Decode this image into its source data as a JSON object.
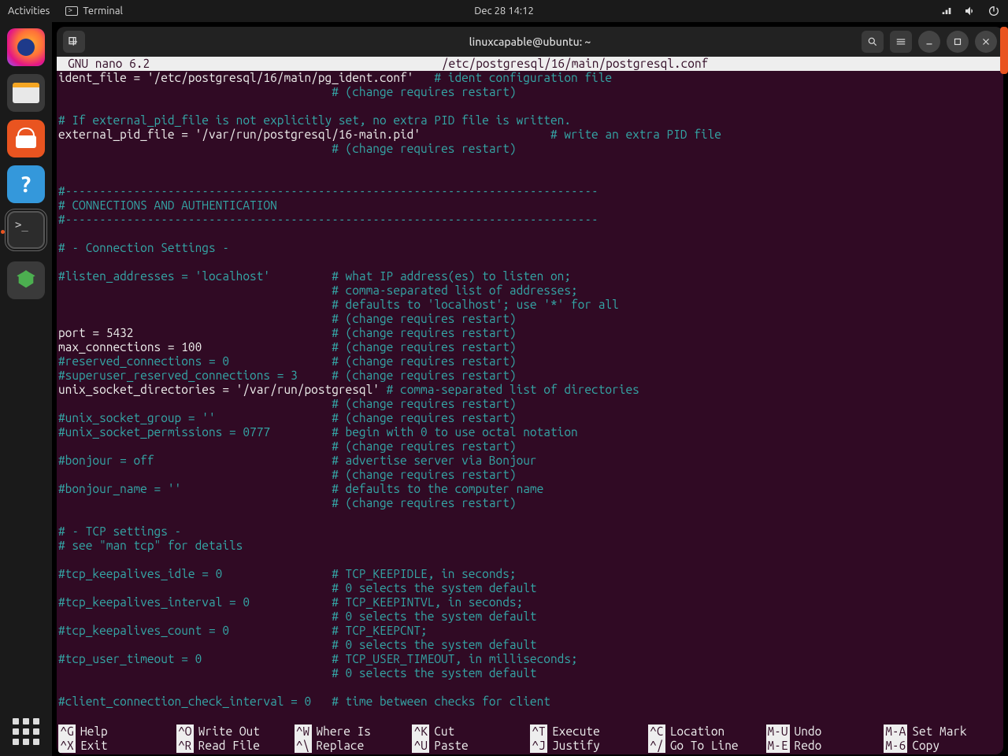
{
  "topbar": {
    "activities": "Activities",
    "terminal": "Terminal",
    "clock": "Dec 28  14:12"
  },
  "window": {
    "title": "linuxcapable@ubuntu: ~"
  },
  "nano": {
    "version": "GNU nano  6.2",
    "filepath": "/etc/postgresql/16/main/postgresql.conf",
    "lines": [
      {
        "t": "n",
        "s": "ident_file = '/etc/postgresql/16/main/pg_ident.conf'   "
      },
      {
        "t": "c",
        "s": "# ident configuration file"
      },
      "BR",
      {
        "t": "c",
        "s": "                                        # (change requires restart)"
      },
      "BR",
      "BR",
      {
        "t": "c",
        "s": "# If external_pid_file is not explicitly set, no extra PID file is written."
      },
      "BR",
      {
        "t": "n",
        "s": "external_pid_file = '/var/run/postgresql/16-main.pid'                   "
      },
      {
        "t": "c",
        "s": "# write an extra PID file"
      },
      "BR",
      {
        "t": "c",
        "s": "                                        # (change requires restart)"
      },
      "BR",
      "BR",
      "BR",
      {
        "t": "c",
        "s": "#------------------------------------------------------------------------------"
      },
      "BR",
      {
        "t": "c",
        "s": "# CONNECTIONS AND AUTHENTICATION"
      },
      "BR",
      {
        "t": "c",
        "s": "#------------------------------------------------------------------------------"
      },
      "BR",
      "BR",
      {
        "t": "c",
        "s": "# - Connection Settings -"
      },
      "BR",
      "BR",
      {
        "t": "c",
        "s": "#listen_addresses = 'localhost'         # what IP address(es) to listen on;"
      },
      "BR",
      {
        "t": "c",
        "s": "                                        # comma-separated list of addresses;"
      },
      "BR",
      {
        "t": "c",
        "s": "                                        # defaults to 'localhost'; use '*' for all"
      },
      "BR",
      {
        "t": "c",
        "s": "                                        # (change requires restart)"
      },
      "BR",
      {
        "t": "n",
        "s": "port = 5432                             "
      },
      {
        "t": "c",
        "s": "# (change requires restart)"
      },
      "BR",
      {
        "t": "n",
        "s": "max_connections = 100                   "
      },
      {
        "t": "c",
        "s": "# (change requires restart)"
      },
      "BR",
      {
        "t": "c",
        "s": "#reserved_connections = 0               # (change requires restart)"
      },
      "BR",
      {
        "t": "c",
        "s": "#superuser_reserved_connections = 3     # (change requires restart)"
      },
      "BR",
      {
        "t": "n",
        "s": "unix_socket_directories = '/var/run/postgresql' "
      },
      {
        "t": "c",
        "s": "# comma-separated list of directories"
      },
      "BR",
      {
        "t": "c",
        "s": "                                        # (change requires restart)"
      },
      "BR",
      {
        "t": "c",
        "s": "#unix_socket_group = ''                 # (change requires restart)"
      },
      "BR",
      {
        "t": "c",
        "s": "#unix_socket_permissions = 0777         # begin with 0 to use octal notation"
      },
      "BR",
      {
        "t": "c",
        "s": "                                        # (change requires restart)"
      },
      "BR",
      {
        "t": "c",
        "s": "#bonjour = off                          # advertise server via Bonjour"
      },
      "BR",
      {
        "t": "c",
        "s": "                                        # (change requires restart)"
      },
      "BR",
      {
        "t": "c",
        "s": "#bonjour_name = ''                      # defaults to the computer name"
      },
      "BR",
      {
        "t": "c",
        "s": "                                        # (change requires restart)"
      },
      "BR",
      "BR",
      {
        "t": "c",
        "s": "# - TCP settings -"
      },
      "BR",
      {
        "t": "c",
        "s": "# see \"man tcp\" for details"
      },
      "BR",
      "BR",
      {
        "t": "c",
        "s": "#tcp_keepalives_idle = 0                # TCP_KEEPIDLE, in seconds;"
      },
      "BR",
      {
        "t": "c",
        "s": "                                        # 0 selects the system default"
      },
      "BR",
      {
        "t": "c",
        "s": "#tcp_keepalives_interval = 0            # TCP_KEEPINTVL, in seconds;"
      },
      "BR",
      {
        "t": "c",
        "s": "                                        # 0 selects the system default"
      },
      "BR",
      {
        "t": "c",
        "s": "#tcp_keepalives_count = 0               # TCP_KEEPCNT;"
      },
      "BR",
      {
        "t": "c",
        "s": "                                        # 0 selects the system default"
      },
      "BR",
      {
        "t": "c",
        "s": "#tcp_user_timeout = 0                   # TCP_USER_TIMEOUT, in milliseconds;"
      },
      "BR",
      {
        "t": "c",
        "s": "                                        # 0 selects the system default"
      },
      "BR",
      "BR",
      {
        "t": "c",
        "s": "#client_connection_check_interval = 0   # time between checks for client"
      },
      "BR"
    ],
    "shortcuts": [
      {
        "k": "^G",
        "l": "Help"
      },
      {
        "k": "^O",
        "l": "Write Out"
      },
      {
        "k": "^W",
        "l": "Where Is"
      },
      {
        "k": "^K",
        "l": "Cut"
      },
      {
        "k": "^T",
        "l": "Execute"
      },
      {
        "k": "^C",
        "l": "Location"
      },
      {
        "k": "M-U",
        "l": "Undo"
      },
      {
        "k": "M-A",
        "l": "Set Mark"
      },
      {
        "k": "^X",
        "l": "Exit"
      },
      {
        "k": "^R",
        "l": "Read File"
      },
      {
        "k": "^\\",
        "l": "Replace"
      },
      {
        "k": "^U",
        "l": "Paste"
      },
      {
        "k": "^J",
        "l": "Justify"
      },
      {
        "k": "^/",
        "l": "Go To Line"
      },
      {
        "k": "M-E",
        "l": "Redo"
      },
      {
        "k": "M-6",
        "l": "Copy"
      }
    ]
  }
}
